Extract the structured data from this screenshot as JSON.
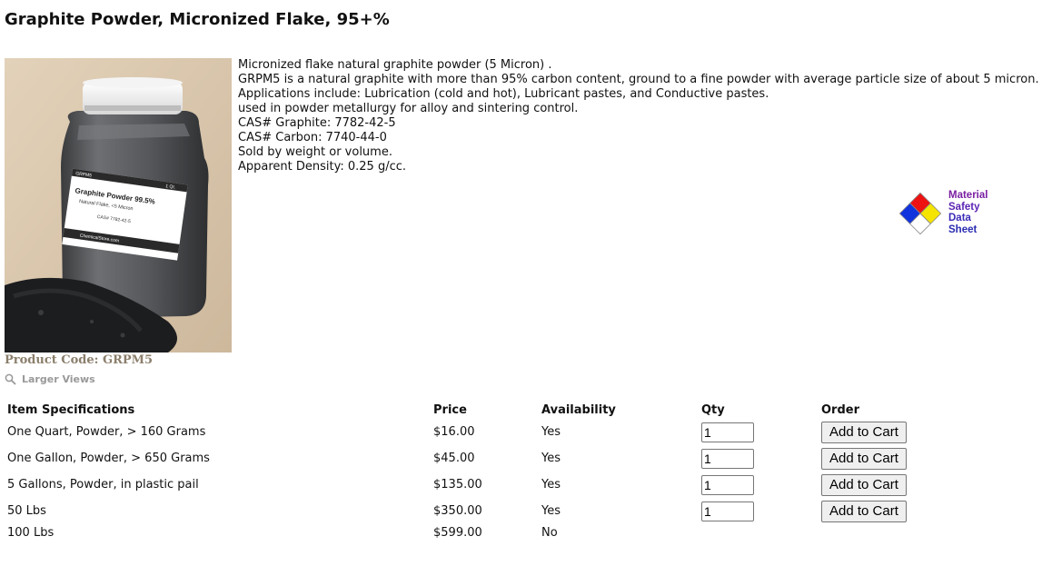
{
  "product": {
    "title": "Graphite Powder, Micronized Flake, 95+%",
    "code": "Product Code: GRPM5",
    "larger_views": "Larger Views",
    "image_label": {
      "top_left": "GRPM5",
      "top_right": "1 Qt.",
      "name": "Graphite Powder 99.5%",
      "sub": "Natural Flake, <5 Micron",
      "cas": "CAS# 7782-42-5",
      "brand": "ChemicalStore.com"
    },
    "description": [
      "Micronized flake natural graphite powder (5 Micron) .",
      "GRPM5 is a natural graphite with more than 95% carbon content, ground to a fine powder with average particle size of about 5 micron.",
      "Applications include: Lubrication (cold and hot), Lubricant pastes, and Conductive pastes.",
      "used in powder metallurgy for alloy and sintering control.",
      "CAS# Graphite: 7782-42-5",
      "CAS# Carbon: 7740-44-0",
      "Sold by weight or volume.",
      "Apparent Density: 0.25 g/cc."
    ]
  },
  "msds": {
    "lines": [
      "Material",
      "Safety",
      "Data",
      "Sheet"
    ],
    "colors": {
      "red": "#ee1111",
      "blue": "#1133dd",
      "yellow": "#f5e400",
      "white": "#ffffff"
    }
  },
  "table": {
    "headers": [
      "Item Specifications",
      "Price",
      "Availability",
      "Qty",
      "Order"
    ],
    "rows": [
      {
        "spec": "One Quart, Powder, > 160 Grams",
        "price": "$16.00",
        "availability": "Yes",
        "qty": "1",
        "button": "Add to Cart"
      },
      {
        "spec": "One Gallon, Powder, > 650 Grams",
        "price": "$45.00",
        "availability": "Yes",
        "qty": "1",
        "button": "Add to Cart"
      },
      {
        "spec": "5 Gallons, Powder, in plastic pail",
        "price": "$135.00",
        "availability": "Yes",
        "qty": "1",
        "button": "Add to Cart"
      },
      {
        "spec": "50 Lbs",
        "price": "$350.00",
        "availability": "Yes",
        "qty": "1",
        "button": "Add to Cart"
      },
      {
        "spec": "100 Lbs",
        "price": "$599.00",
        "availability": "No"
      }
    ]
  }
}
